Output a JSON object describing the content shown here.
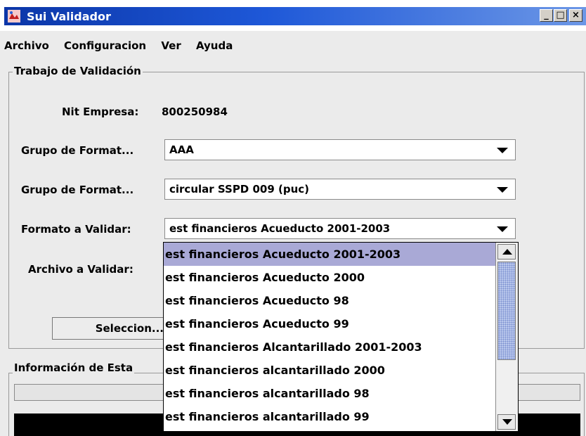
{
  "window": {
    "title": "Sui Validador",
    "minimize": "_",
    "maximize": "□",
    "close": "×"
  },
  "menu": [
    "Archivo",
    "Configuracion",
    "Ver",
    "Ayuda"
  ],
  "job_panel": {
    "title": "Trabajo de Validación",
    "nit_label": "Nit Empresa:",
    "nit_value": "800250984",
    "group1_label": "Grupo de Format...",
    "group1_value": "AAA",
    "group2_label": "Grupo de Format...",
    "group2_value": "circular SSPD 009 (puc)",
    "format_label": "Formato a Validar:",
    "format_value": "est financieros Acueducto 2001-2003",
    "file_label": "Archivo a Validar:",
    "select_button": "Seleccion..."
  },
  "status_panel": {
    "title": "Información de Esta"
  },
  "dropdown_items": [
    "est financieros Acueducto 2001-2003",
    "est financieros Acueducto 2000",
    "est financieros Acueducto 98",
    "est financieros Acueducto 99",
    "est financieros Alcantarillado 2001-2003",
    "est financieros alcantarillado 2000",
    "est financieros alcantarillado 98",
    "est financieros alcantarillado 99"
  ],
  "dropdown_selected_index": 0,
  "colors": {
    "titlebar": "#0b36a8",
    "selection": "#a9a9d6",
    "console": "#000000"
  }
}
